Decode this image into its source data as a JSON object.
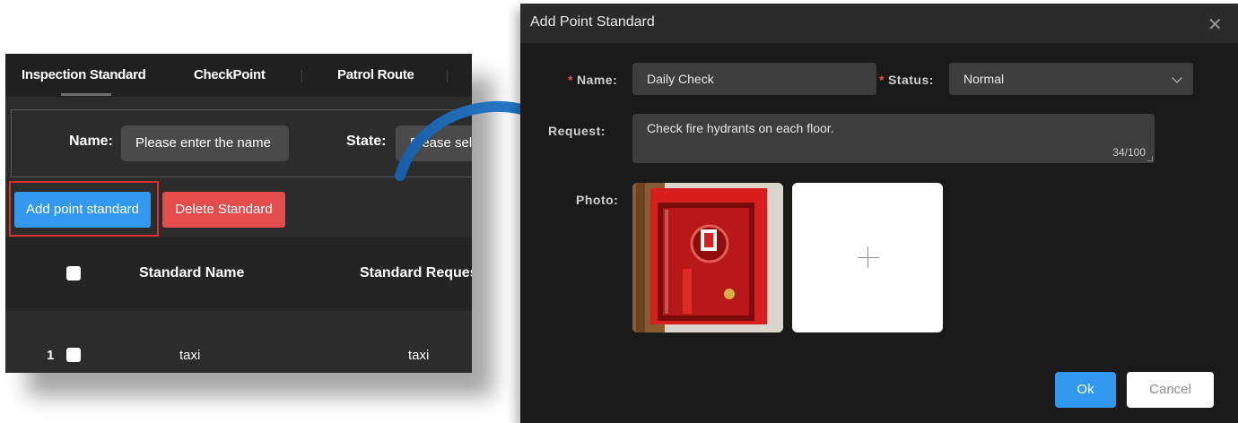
{
  "tabs": [
    {
      "label": "Inspection Standard",
      "active": true
    },
    {
      "label": "CheckPoint",
      "active": false
    },
    {
      "label": "Patrol Route",
      "active": false
    }
  ],
  "filter": {
    "name_label": "Name:",
    "name_placeholder": "Please enter the name",
    "state_label": "State:",
    "state_placeholder": "Please sele"
  },
  "actions": {
    "add_label": "Add point standard",
    "delete_label": "Delete Standard"
  },
  "table": {
    "columns": [
      "Standard Name",
      "Standard Reques"
    ],
    "rows": [
      {
        "index": "1",
        "name": "taxi",
        "request": "taxi"
      }
    ]
  },
  "dialog": {
    "title": "Add Point Standard",
    "name_label": "Name:",
    "name_value": "Daily Check",
    "status_label": "Status:",
    "status_value": "Normal",
    "request_label": "Request:",
    "request_value": "Check fire hydrants on each floor.",
    "request_counter": "34/100",
    "photo_label": "Photo:",
    "ok_label": "Ok",
    "cancel_label": "Cancel",
    "required_mark": "*"
  },
  "colors": {
    "primary": "#3399f0",
    "danger": "#e54d4d",
    "highlight": "#d8322f",
    "arrow": "#1f6fbf"
  }
}
